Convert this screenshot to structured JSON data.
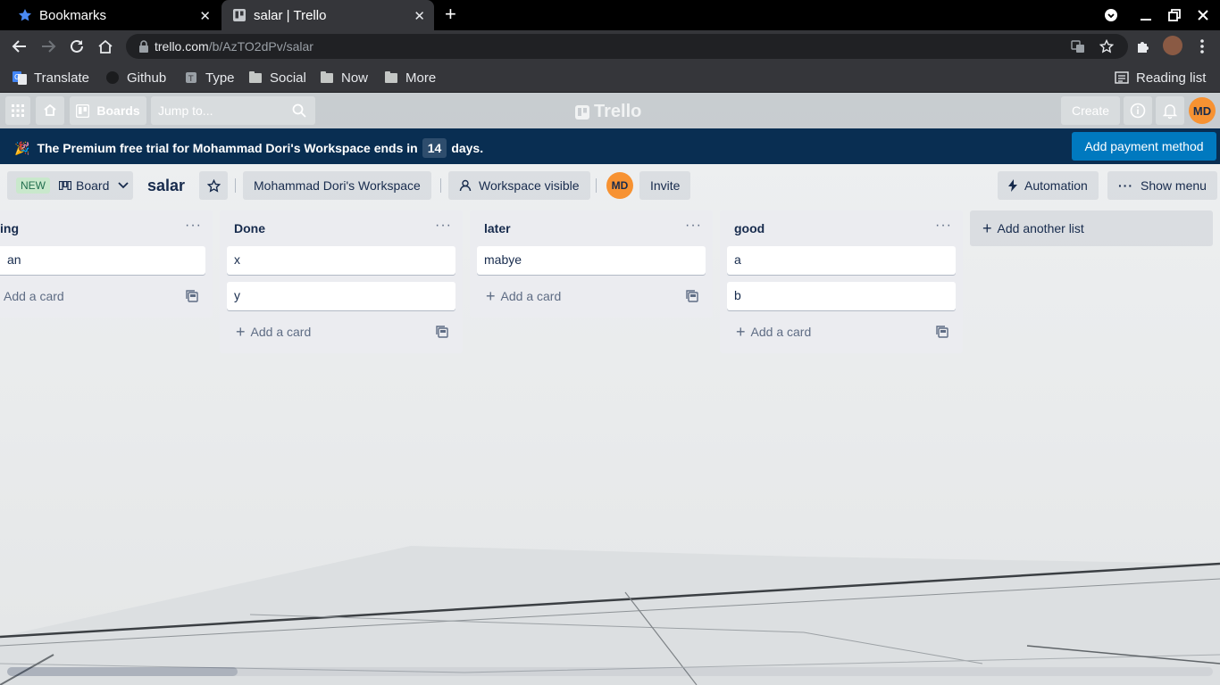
{
  "browser": {
    "tabs": [
      {
        "title": "Bookmarks",
        "icon": "star-icon",
        "active": false
      },
      {
        "title": "salar | Trello",
        "icon": "trello-icon",
        "active": true
      }
    ],
    "url_host": "trello.com",
    "url_path": "/b/AzTO2dPv/salar",
    "bookmarks": [
      {
        "label": "Translate",
        "icon": "google-translate-icon"
      },
      {
        "label": "Github",
        "icon": "github-icon"
      },
      {
        "label": "Type",
        "icon": "type-icon"
      },
      {
        "label": "Social",
        "icon": "folder-icon"
      },
      {
        "label": "Now",
        "icon": "folder-icon"
      },
      {
        "label": "More",
        "icon": "folder-icon"
      }
    ],
    "reading_list": "Reading list"
  },
  "header": {
    "boards_label": "Boards",
    "jump_placeholder": "Jump to...",
    "logo_text": "Trello",
    "create_label": "Create",
    "avatar_initials": "MD"
  },
  "banner": {
    "emoji": "🎉",
    "message_before": "The Premium free trial for Mohammad Dori's Workspace ends in",
    "days": "14",
    "message_after": "days.",
    "button_label": "Add payment method"
  },
  "board": {
    "new_badge": "NEW",
    "view_label": "Board",
    "name": "salar",
    "workspace": "Mohammad Dori's Workspace",
    "visibility": "Workspace visible",
    "member_initials": "MD",
    "invite_label": "Invite",
    "automation_label": "Automation",
    "show_menu_label": "Show menu",
    "add_list_label": "Add another list",
    "lists": [
      {
        "title": "ing",
        "cards": [
          "an"
        ],
        "add_card": "Add a card"
      },
      {
        "title": "Done",
        "cards": [
          "x",
          "y"
        ],
        "add_card": "Add a card"
      },
      {
        "title": "later",
        "cards": [
          "mabye"
        ],
        "add_card": "Add a card"
      },
      {
        "title": "good",
        "cards": [
          "a",
          "b"
        ],
        "add_card": "Add a card"
      }
    ]
  },
  "colors": {
    "banner_bg": "#092e52",
    "primary_button": "#0079bf",
    "avatar": "#f79232",
    "list_bg": "#ebecf0"
  }
}
